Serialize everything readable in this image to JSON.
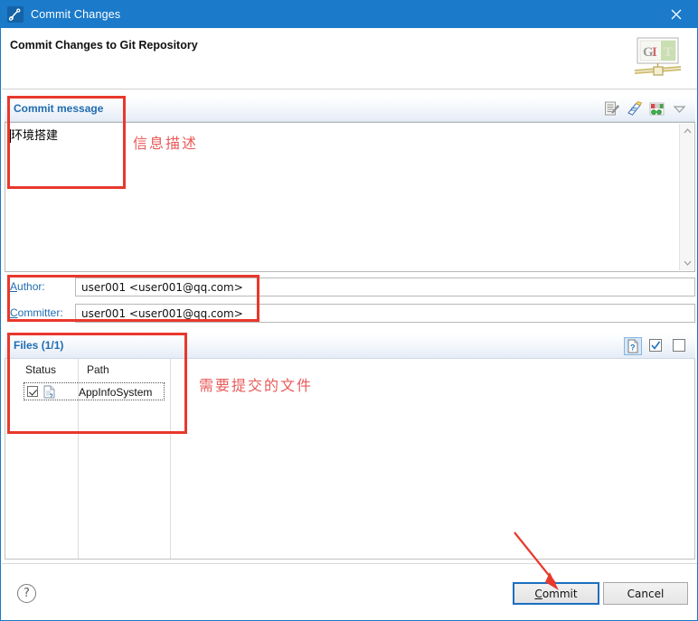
{
  "window": {
    "title": "Commit Changes",
    "title_icon": "git-commit-icon",
    "close_icon": "close-icon"
  },
  "header": {
    "heading": "Commit Changes to Git Repository",
    "logo_text": "GIT",
    "logo_icon": "git-logo-icon"
  },
  "commit_message": {
    "section_label": "Commit message",
    "value": "环境搭建",
    "placeholder": "",
    "tools": [
      {
        "name": "spellcheck-icon"
      },
      {
        "name": "signed-off-by-icon"
      },
      {
        "name": "amend-commit-icon"
      },
      {
        "name": "chevron-down-icon"
      }
    ],
    "scrollbar": {
      "up": "▲",
      "down": "▼"
    }
  },
  "identity": {
    "author": {
      "label": "Author:",
      "mnemonic": "A",
      "label_rest": "uthor:",
      "value": "user001  <user001@qq.com>"
    },
    "committer": {
      "label": "Committer:",
      "mnemonic": "C",
      "label_rest": "ommitter:",
      "value": "user001  <user001@qq.com>"
    }
  },
  "files": {
    "section_label": "Files",
    "count_label": "(1/1)",
    "tools": [
      {
        "name": "show-untracked-files-icon",
        "selected": true
      },
      {
        "name": "select-all-icon",
        "selected": false
      },
      {
        "name": "deselect-all-icon",
        "selected": false
      }
    ],
    "columns": [
      "Status",
      "Path"
    ],
    "rows": [
      {
        "checked": true,
        "status_icon": "untracked-file-icon",
        "path": "AppInfoSystem"
      }
    ]
  },
  "footer": {
    "help_icon": "help-icon",
    "help_glyph": "?",
    "commit_button": {
      "mnemonic": "C",
      "rest": "ommit",
      "full": "Commit"
    },
    "cancel_button": {
      "full": "Cancel"
    }
  },
  "annotations": {
    "message_note": "信息描述",
    "files_note": "需要提交的文件",
    "arrow_target": "commit-button"
  },
  "colors": {
    "titlebar": "#1b7ac9",
    "section_heading": "#1f6cb0",
    "annotation_red": "#e8382c",
    "annotation_text": "#ea5a5a",
    "focus_border": "#1b6fc0"
  }
}
